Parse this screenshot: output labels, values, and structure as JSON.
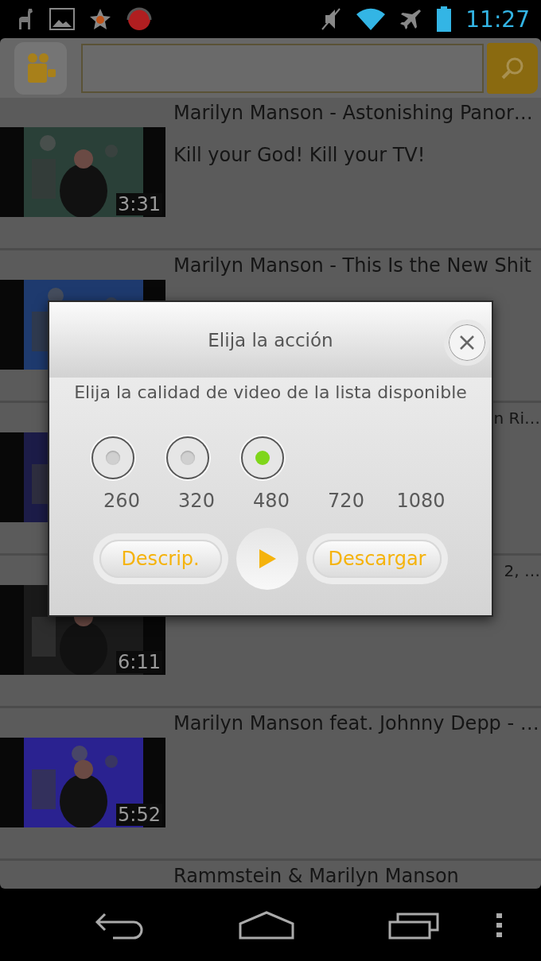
{
  "status_bar": {
    "time": "11:27"
  },
  "videos": [
    {
      "title": "Marilyn Manson - Astonishing Panor…",
      "description": "Kill your God! Kill your TV!",
      "duration": "3:31",
      "partial": false
    },
    {
      "title": "Marilyn Manson - This Is the New Shit",
      "partial": false
    },
    {
      "title": "n Ri…",
      "partial": true
    },
    {
      "title": "2, …",
      "duration": "6:11",
      "partial": true
    },
    {
      "title": "Marilyn Manson feat. Johnny Depp - …",
      "duration": "5:52",
      "partial": false
    },
    {
      "title": "Rammstein & Marilyn Manson",
      "partial": false
    }
  ],
  "dialog": {
    "title": "Elija la acción",
    "message": "Elija la calidad de video de la lista disponible",
    "options": [
      {
        "label": "260",
        "kind": "radio",
        "selected": false
      },
      {
        "label": "320",
        "kind": "radio",
        "selected": false
      },
      {
        "label": "480",
        "kind": "radio",
        "selected": true
      },
      {
        "label": "720",
        "kind": "plain"
      },
      {
        "label": "1080",
        "kind": "plain"
      }
    ],
    "buttons": [
      {
        "label": "Descrip.",
        "kind": "text"
      },
      {
        "kind": "play"
      },
      {
        "label": "Descargar",
        "kind": "text"
      }
    ]
  }
}
